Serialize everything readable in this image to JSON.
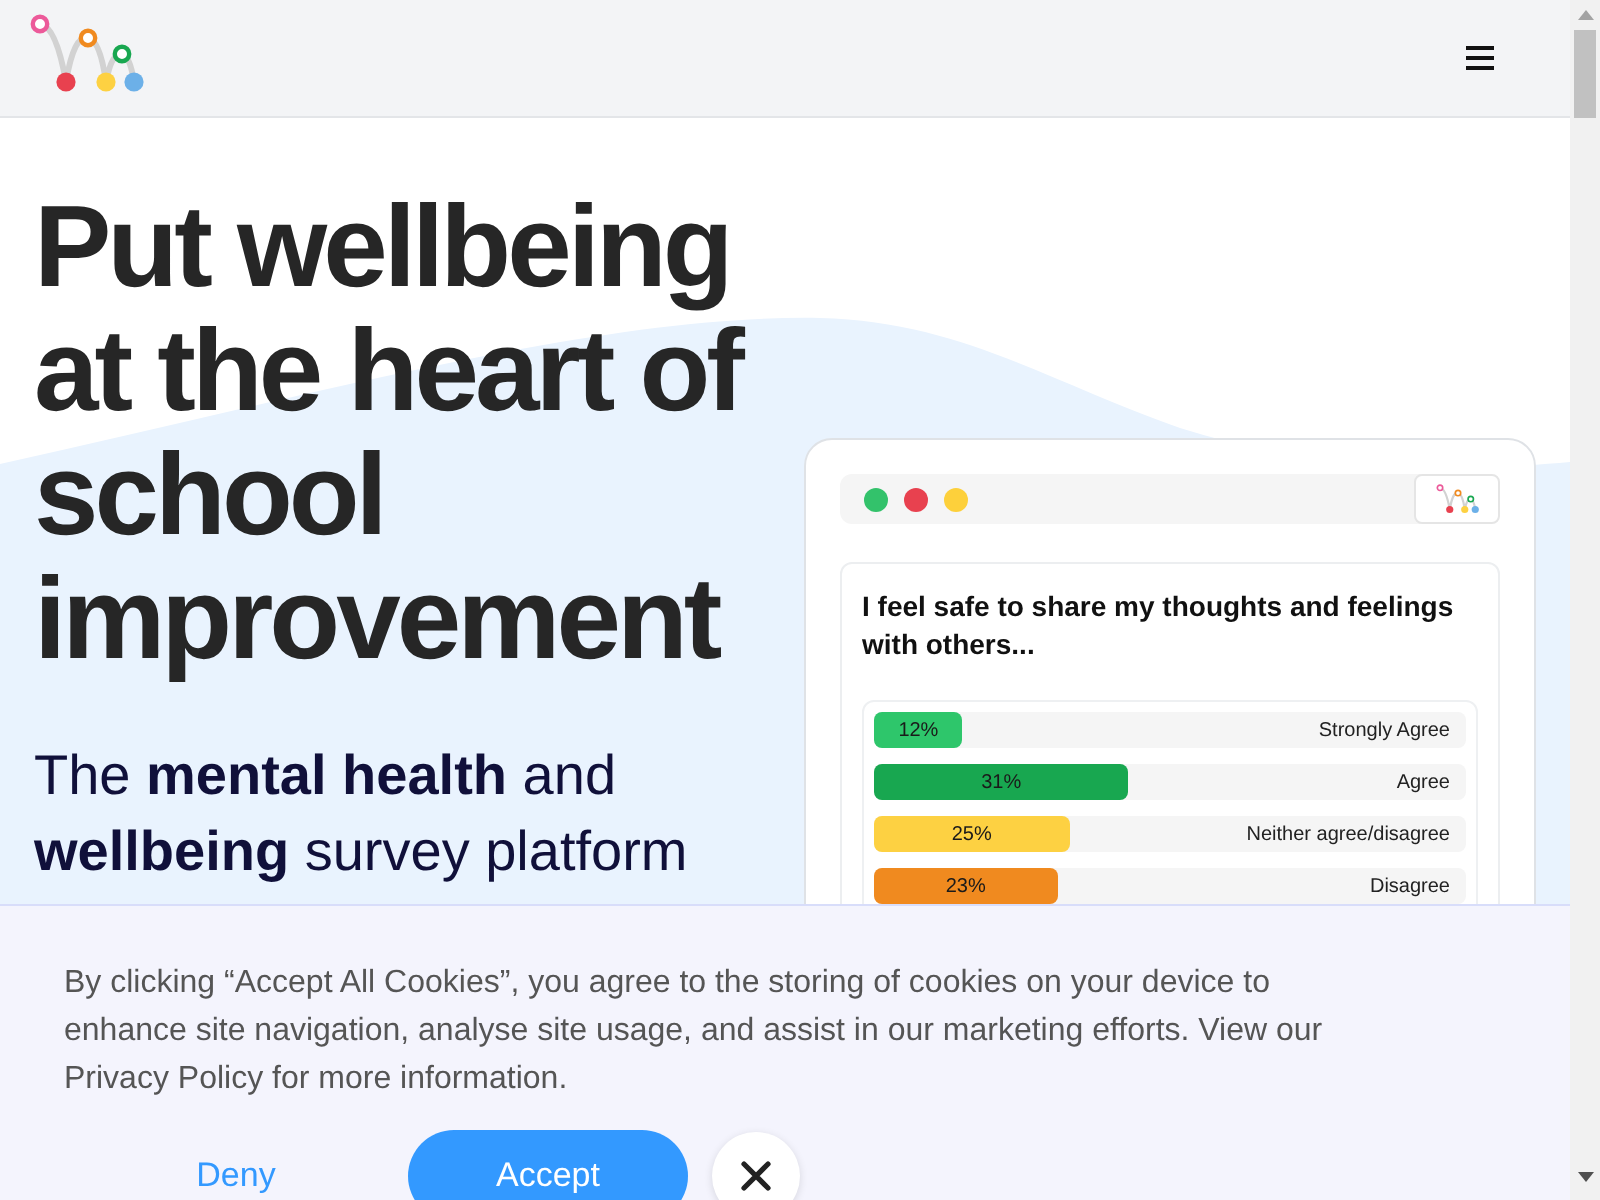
{
  "hero": {
    "title": "Put wellbeing at the heart of school improvement",
    "subtitle": "The **mental health** and **wellbeing** survey platform"
  },
  "survey_card": {
    "question": "I feel safe to share my thoughts and feelings with others...",
    "responses": [
      {
        "label": "Strongly Agree",
        "reading": "12%",
        "level": 0.15,
        "color": "#2ec66b"
      },
      {
        "label": "Agree",
        "reading": "31%",
        "level": 0.43,
        "color": "#18a750"
      },
      {
        "label": "Neither agree/disagree",
        "reading": "25%",
        "level": 0.33,
        "color": "#fdd142"
      },
      {
        "label": "Disagree",
        "reading": "23%",
        "level": 0.31,
        "color": "#f08a1f"
      }
    ]
  },
  "cookie_banner": {
    "text": "By clicking “Accept All Cookies”, you agree to the storing of cookies on your device to enhance site navigation, analyse site usage, and assist in our marketing efforts. View our Privacy Policy for more information.",
    "buttons": [
      {
        "label": "Deny",
        "kind": "link"
      },
      {
        "label": "Accept",
        "kind": "primary"
      }
    ]
  }
}
